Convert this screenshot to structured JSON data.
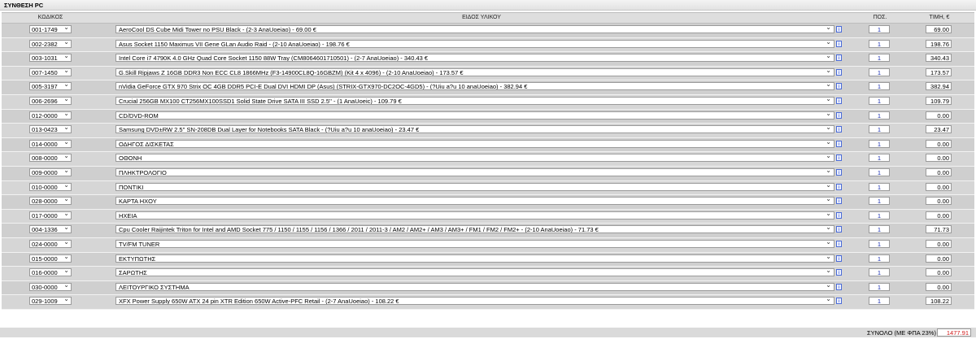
{
  "page": {
    "title": "ΣΥΝΘΕΣΗ PC"
  },
  "header": {
    "code": "ΚΩΔΙΚΟΣ",
    "item": "ΕΙΔΟΣ ΥΛΙΚΟΥ",
    "qty": "ΠΟΣ.",
    "price": "ΤΙΜΗ, €"
  },
  "rows": [
    {
      "code": "001-1749",
      "desc": "AeroCool DS Cube Midi Tower no PSU Black - (2-3 AnaUoeiao) - 69.00 €",
      "qty": "1",
      "price": "69.00"
    },
    {
      "code": "002-2382",
      "desc": "Asus Socket 1150 Maximus VII Gene GLan Audio Raid - (2-10 AnaUoeiao) - 198.76 €",
      "qty": "1",
      "price": "198.76"
    },
    {
      "code": "003-1031",
      "desc": "Intel Core i7 4790K 4.0 GHz Quad Core Socket 1150 88W Tray (CM8064601710501) - (2-7 AnaUoeiao) - 340.43 €",
      "qty": "1",
      "price": "340.43"
    },
    {
      "code": "007-1450",
      "desc": "G.Skill Ripjaws Z 16GB DDR3 Non ECC CL8 1866MHz (F3-14900CL8Q-16GBZM) (Kit 4 x 4096) - (2-10 AnaUoeiao) - 173.57 €",
      "qty": "1",
      "price": "173.57"
    },
    {
      "code": "005-3197",
      "desc": "nVidia GeForce GTX 970 Strix OC 4GB DDR5 PCI-E Dual DVI HDMI DP (Asus) (STRIX-GTX970-DC2OC-4GD5) - (?Uiu a?u 10 anaUoeiao) - 382.94 €",
      "qty": "1",
      "price": "382.94"
    },
    {
      "code": "006-2696",
      "desc": "Crucial 256GB MX100 CT256MX100SSD1 Solid State Drive SATA III SSD 2.5'' - (1 AnaUoeic) - 109.79 €",
      "qty": "1",
      "price": "109.79"
    },
    {
      "code": "012-0000",
      "desc": "CD/DVD-ROM",
      "qty": "1",
      "price": "0.00"
    },
    {
      "code": "013-0423",
      "desc": "Samsung DVD±RW 2.5'' SN-208DB Dual Layer for Notebooks SATA Black - (?Uiu a?u 10 anaUoeiao) - 23.47 €",
      "qty": "1",
      "price": "23.47"
    },
    {
      "code": "014-0000",
      "desc": "ΟΔΗΓΟΣ ΔΙΣΚΕΤΑΣ",
      "qty": "1",
      "price": "0.00"
    },
    {
      "code": "008-0000",
      "desc": "ΟΘΟΝΗ",
      "qty": "1",
      "price": "0.00"
    },
    {
      "code": "009-0000",
      "desc": "ΠΛΗΚΤΡΟΛΟΓΙΟ",
      "qty": "1",
      "price": "0.00"
    },
    {
      "code": "010-0000",
      "desc": "ΠΟΝΤΙΚΙ",
      "qty": "1",
      "price": "0.00"
    },
    {
      "code": "028-0000",
      "desc": "ΚΑΡΤΑ ΗΧΟΥ",
      "qty": "1",
      "price": "0.00"
    },
    {
      "code": "017-0000",
      "desc": "ΗΧΕΙΑ",
      "qty": "1",
      "price": "0.00"
    },
    {
      "code": "004-1336",
      "desc": "Cpu Cooler Raijintek Triton for Intel and AMD Socket 775 / 1150 / 1155 / 1156 / 1366 / 2011 / 2011-3 / AM2 / AM2+ / AM3 / AM3+ / FM1 / FM2 / FM2+ - (2-10 AnaUoeiao) - 71.73 €",
      "qty": "1",
      "price": "71.73"
    },
    {
      "code": "024-0000",
      "desc": "TV/FM TUNER",
      "qty": "1",
      "price": "0.00"
    },
    {
      "code": "015-0000",
      "desc": "ΕΚΤΥΠΩΤΗΣ",
      "qty": "1",
      "price": "0.00"
    },
    {
      "code": "016-0000",
      "desc": "ΣΑΡΩΤΗΣ",
      "qty": "1",
      "price": "0.00"
    },
    {
      "code": "030-0000",
      "desc": "ΛΕΙΤΟΥΡΓΙΚΟ ΣΥΣΤΗΜΑ",
      "qty": "1",
      "price": "0.00"
    },
    {
      "code": "029-1009",
      "desc": "XFX Power Supply 650W ATX 24 pin XTR Edition 650W Active-PFC Retail - (2-7 AnaUoeiao) - 108.22 €",
      "qty": "1",
      "price": "108.22"
    }
  ],
  "info_icon_label": "i",
  "total": {
    "label": "ΣΥΝΟΛΟ (ΜΕ ΦΠΑ 23%)",
    "value": "1477.91"
  },
  "colors": {
    "header_bg": "#dedede",
    "row_bg": "#cfcfcf",
    "qty_text": "#1a2fb0",
    "total_text": "#d01818"
  }
}
